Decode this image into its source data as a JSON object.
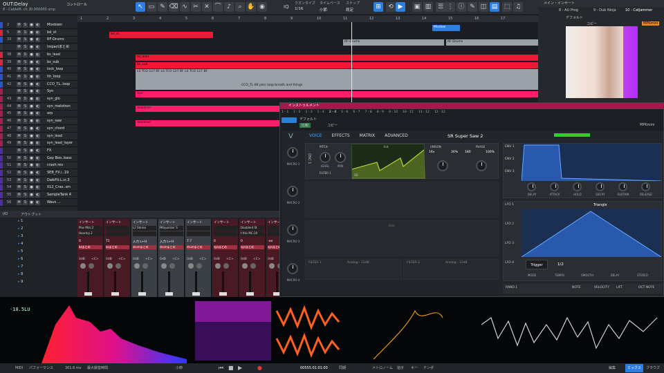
{
  "header": {
    "track_name": "OUT:Delay",
    "track_sub": "8 - CableM..ch 2",
    "samples": "0.000000 smp",
    "control_label": "コントロール",
    "quantize_label": "クオンタイズ",
    "quantize_value": "1/16",
    "timebase_label": "タイムベース",
    "timebase_value": "小節",
    "snap_label": "スナップ",
    "snap_value": "既定",
    "iq_label": "IQ"
  },
  "browser": {
    "title": "メイン・インサート",
    "preset": "10 - CatJammer",
    "default_label": "デフォルト",
    "copy_label": "コピー",
    "mpk_label": "MPKmini",
    "channel_a": "8 - AU Prog",
    "channel_b": "9 - Dub Ninja"
  },
  "tracks": [
    {
      "num": "2",
      "name": "Mixdown",
      "color": "#2a55c0"
    },
    {
      "num": "5",
      "name": "bd_st",
      "color": "#d4283a"
    },
    {
      "num": "33",
      "name": "RF-Drums",
      "color": "#2a55c0"
    },
    {
      "num": "",
      "name": "Impactまとめ",
      "color": "#333"
    },
    {
      "num": "38",
      "name": "bs_lead",
      "color": "#d4283a"
    },
    {
      "num": "39",
      "name": "bs_sub",
      "color": "#d4283a"
    },
    {
      "num": "40",
      "name": "lock_loop",
      "color": "#2a55c0"
    },
    {
      "num": "41",
      "name": "hh_loop",
      "color": "#2a55c0"
    },
    {
      "num": "42",
      "name": "CCO_TL..loop",
      "color": "#2a55c0"
    },
    {
      "num": "",
      "name": "Syn",
      "color": "#a02050"
    },
    {
      "num": "43",
      "name": "syn_glo",
      "color": "#a02050"
    },
    {
      "num": "44",
      "name": "syn_melotron",
      "color": "#a02050"
    },
    {
      "num": "45",
      "name": "arp",
      "color": "#a02050"
    },
    {
      "num": "46",
      "name": "syn_saw",
      "color": "#a02050"
    },
    {
      "num": "47",
      "name": "syn_chord",
      "color": "#a02050"
    },
    {
      "num": "48",
      "name": "syn_lead",
      "color": "#a02050"
    },
    {
      "num": "49",
      "name": "syn_lead_layer",
      "color": "#a02050"
    },
    {
      "num": "",
      "name": "FX",
      "color": "#5030a0"
    },
    {
      "num": "50",
      "name": "Gay Boo..bass",
      "color": "#5030a0"
    },
    {
      "num": "51",
      "name": "crash rev",
      "color": "#5030a0"
    },
    {
      "num": "52",
      "name": "SEB_FX.i..19",
      "color": "#5030a0"
    },
    {
      "num": "53",
      "name": "DaikFlt.L.cr.3",
      "color": "#5030a0"
    },
    {
      "num": "54",
      "name": "012_Cras..sm",
      "color": "#5030a0"
    },
    {
      "num": "55",
      "name": "SampleTank 4",
      "color": "#5030a0"
    },
    {
      "num": "56",
      "name": "Wavs ...",
      "color": "#5030a0"
    }
  ],
  "ruler": [
    "1",
    "2",
    "3",
    "4",
    "5",
    "6",
    "7",
    "8",
    "9",
    "10",
    "11",
    "12",
    "13",
    "14",
    "15",
    "16",
    "17"
  ],
  "clips": {
    "bd_st": "bd_st",
    "rf_drums": "RF-Drums",
    "rf_drums2": "RF-Drums",
    "mixdown": "Mixdow",
    "bs_lead": "bs_lead",
    "bs_sub": "bs_sub",
    "syn": "Syn",
    "melotron": "melotron",
    "lstco": "LS TCO 127 BF LS TCO 127 BF LS TCO 127 BF",
    "loop": "CCO_TL 86 perc loop breath and things"
  },
  "instrument": {
    "title": "インストゥルメント",
    "patterns": [
      "1 - 1",
      "1 - 2",
      "1 - 3",
      "1 - 4",
      "2 - 4",
      "5 - 6",
      "6 - 7",
      "7 - 8",
      "8 - 9",
      "9 - 10",
      "10 - 11",
      "11 - 12",
      "12 - 12"
    ],
    "compare_label": "比較",
    "copy_label": "コピー",
    "default_label": "デフォルト",
    "preset_label": "MPKmini",
    "tabs": [
      "VOICE",
      "EFFECTS",
      "MATRIX",
      "ADVANCED"
    ],
    "active_tab": "VOICE",
    "preset_name": "SR Super Saw 2",
    "osc_label": "OSC 1",
    "wave_label": "Init",
    "filter_label": "FILTER 1",
    "pitch_label": "PITCH",
    "unison_label": "UNISON",
    "phase_label": "PHASE",
    "level_label": "LEVEL",
    "pan_label": "PAN",
    "unison_val1": "16v",
    "unison_val2": "30%",
    "phase_val1": "180",
    "phase_val2": "100%",
    "dim_label": "2D",
    "macros": [
      "MACRO 1",
      "MACRO 2",
      "MACRO 3",
      "MACRO 4"
    ],
    "env_labels": [
      "ENV 1",
      "ENV 2",
      "ENV 3"
    ],
    "env_knobs": [
      "DELAY",
      "ATTACK",
      "HOLD",
      "DECAY",
      "SUSTAIN",
      "RELEASE"
    ],
    "lfo_labels": [
      "LFO 1",
      "LFO 2",
      "LFO 3",
      "LFO 4"
    ],
    "lfo_shape": "Triangle",
    "lfo_knobs": [
      "MODE",
      "TEMPO",
      "SMOOTH",
      "DELAY",
      "STEREO"
    ],
    "lfo_trigger": "Trigger",
    "lfo_rate": "1/2",
    "bottom_labels": [
      "RAND 1",
      "NOTE",
      "VELOCITY",
      "LIFT",
      "OCT NOTE"
    ],
    "filter2_label": "FILTER 1",
    "filter2_note": "Analog : 12dB",
    "filter3_label": "FILTER 2",
    "filter3_note": "Analog : 12dB",
    "sub_label": "Sine"
  },
  "mixer": {
    "io_label": "I/O",
    "channel_list_label": "アウトプット",
    "inputs": [
      "1",
      "2",
      "3",
      "4",
      "5",
      "6",
      "7",
      "8",
      "9"
    ],
    "strips": [
      {
        "insert": "インサート",
        "plugin": "Plus Mini 2",
        "plugin2": "Heartcp 2",
        "in": "0",
        "route": "bsまとめ",
        "db": "0dB",
        "pan": "<C>"
      },
      {
        "insert": "インサート",
        "plugin": "",
        "plugin2": "",
        "in": "T1",
        "route": "bsまとめ",
        "db": "0dB",
        "pan": "<C>"
      },
      {
        "insert": "インサート",
        "plugin": "L2 Stereo",
        "plugin2": "",
        "in": "入力 L+H",
        "route": "drumまとめ",
        "db": "0dB",
        "pan": "<C>"
      },
      {
        "insert": "インサート",
        "plugin": "MEqualizer S",
        "plugin2": "",
        "in": "入力 L+H",
        "route": "drumまとめ",
        "db": "0dB",
        "pan": "<C>"
      },
      {
        "insert": "インサート",
        "plugin": "",
        "plugin2": "",
        "in": "7.7",
        "route": "drumまとめ",
        "db": "0dB",
        "pan": "<C>"
      },
      {
        "insert": "インサート",
        "plugin": "",
        "plugin2": "",
        "in": "0",
        "route": "synまとめ",
        "db": "0dB",
        "pan": "<C>"
      },
      {
        "insert": "インサート",
        "plugin": "Doubler4 St",
        "plugin2": "t this MC-20",
        "in": "0",
        "route": "synまとめ",
        "db": "0dB",
        "pan": "<C>"
      },
      {
        "insert": "インサート",
        "plugin": "",
        "plugin2": "",
        "in": "-oo",
        "route": "synまとめ",
        "db": "0dB",
        "pan": "<C>"
      }
    ]
  },
  "scope": {
    "level": "-10.5LU"
  },
  "status": {
    "midi": "MIDI",
    "perf": "パフォーマンス",
    "ms": "301.6 ms",
    "max_time": "最大録音時間",
    "arr_label": "小節",
    "position": "00555.01.01.00",
    "sync": "同期",
    "metro": "メトロノーム",
    "beat": "拍子",
    "key": "キー",
    "tempo": "テンポ",
    "edit": "編集",
    "mix": "ミックス",
    "browse": "ブラウズ"
  },
  "colors": {
    "accent": "#2e7de0",
    "clip_red": "#ee1a35",
    "clip_pink": "#ff1e6a",
    "clip_grey": "#9aa1a8",
    "vital_bg": "#222529"
  }
}
